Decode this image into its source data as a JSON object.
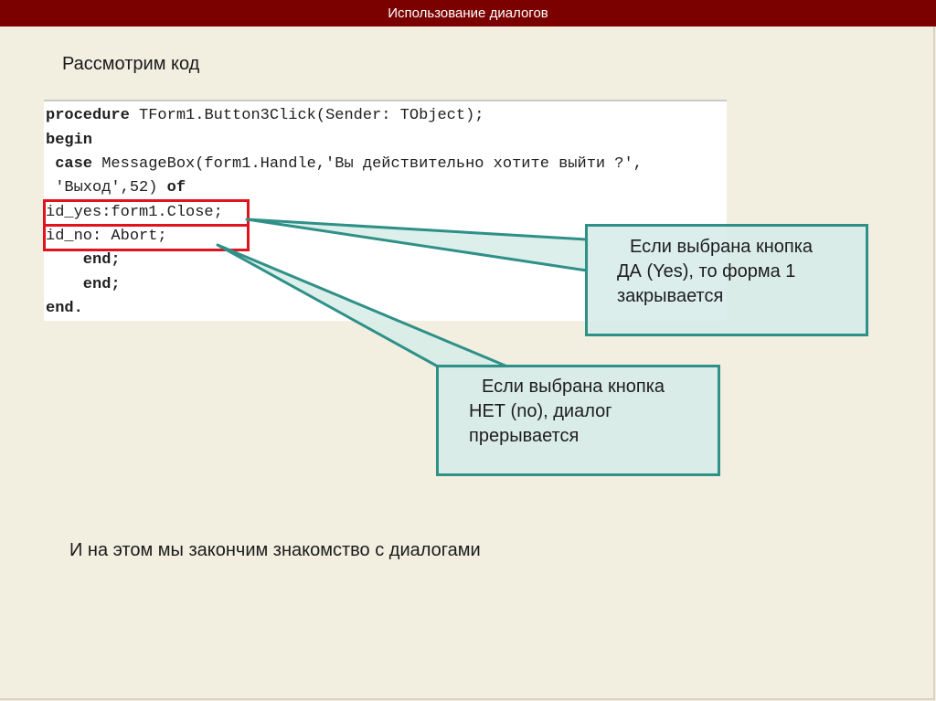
{
  "header": {
    "title": "Использование диалогов"
  },
  "heading": "Рассмотрим код",
  "code": {
    "lines": [
      {
        "kw": "procedure",
        "rest": " TForm1.Button3Click(Sender: TObject);"
      },
      {
        "kw": "begin",
        "rest": ""
      },
      {
        "kw": " case",
        "rest": " MessageBox(form1.Handle,'Вы действительно хотите выйти ?',"
      },
      {
        "kw": "",
        "rest": " 'Выход',52)",
        "kw2": " of"
      },
      {
        "kw": "",
        "rest": "id_yes:form1.Close;"
      },
      {
        "kw": "",
        "rest": "id_no: Abort;"
      },
      {
        "kw": "    end;",
        "rest": ""
      },
      {
        "kw": "    end;",
        "rest": ""
      },
      {
        "kw": "end.",
        "rest": ""
      }
    ]
  },
  "callouts": {
    "yes": {
      "line1": "Если выбрана кнопка",
      "line2": "ДА (Yes), то форма 1",
      "line3": "закрывается"
    },
    "no": {
      "line1": "Если выбрана кнопка",
      "line2": "НЕТ (no), диалог",
      "line3": "прерывается"
    }
  },
  "footer": "И на этом мы закончим знакомство с диалогами",
  "colors": {
    "title_bar": "#7b0000",
    "background": "#f2efe1",
    "highlight_box": "#e0141e",
    "callout_border": "#2f9088",
    "callout_fill": "#d6ece8"
  }
}
